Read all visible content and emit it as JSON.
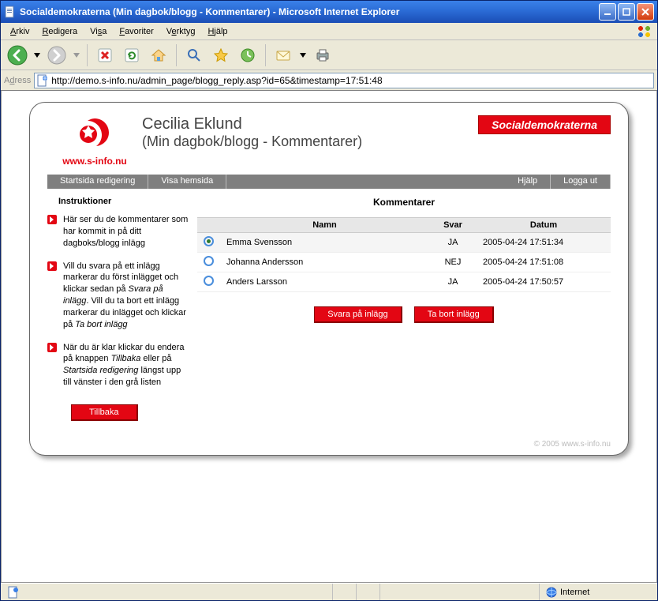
{
  "browser": {
    "title": "Socialdemokraterna (Min dagbok/blogg - Kommentarer) - Microsoft Internet Explorer",
    "menu": [
      "Arkiv",
      "Redigera",
      "Visa",
      "Favoriter",
      "Verktyg",
      "Hjälp"
    ],
    "address_label": "Adress",
    "url": "http://demo.s-info.nu/admin_page/blogg_reply.asp?id=65&timestamp=17:51:48",
    "status_zone": "Internet"
  },
  "header": {
    "site_label": "www.s-info.nu",
    "person": "Cecilia Eklund",
    "subtitle": "(Min dagbok/blogg - Kommentarer)",
    "party_badge": "Socialdemokraterna"
  },
  "nav": {
    "items": [
      "Startsida redigering",
      "Visa hemsida",
      "Hjälp",
      "Logga ut"
    ]
  },
  "instructions": {
    "heading": "Instruktioner",
    "items": [
      "Här ser du de kommentarer som har kommit in på ditt dagboks/blogg inlägg",
      "Vill du svara på ett inlägg markerar du först inlägget och klickar sedan på <em>Svara på inlägg</em>. Vill du ta bort ett inlägg markerar du inlägget och klickar på <em>Ta bort inlägg</em>",
      "När du är klar klickar du endera på knappen <em>Tillbaka</em> eller på <em>Startsida redigering</em> längst upp till vänster i den grå listen"
    ],
    "back_button": "Tillbaka"
  },
  "comments": {
    "heading": "Kommentarer",
    "columns": {
      "name": "Namn",
      "answer": "Svar",
      "date": "Datum"
    },
    "rows": [
      {
        "selected": true,
        "name": "Emma Svensson",
        "answer": "JA",
        "date": "2005-04-24 17:51:34"
      },
      {
        "selected": false,
        "name": "Johanna Andersson",
        "answer": "NEJ",
        "date": "2005-04-24 17:51:08"
      },
      {
        "selected": false,
        "name": "Anders Larsson",
        "answer": "JA",
        "date": "2005-04-24 17:50:57"
      }
    ],
    "actions": {
      "reply": "Svara på inlägg",
      "delete": "Ta bort inlägg"
    }
  },
  "footer": "© 2005 www.s-info.nu"
}
